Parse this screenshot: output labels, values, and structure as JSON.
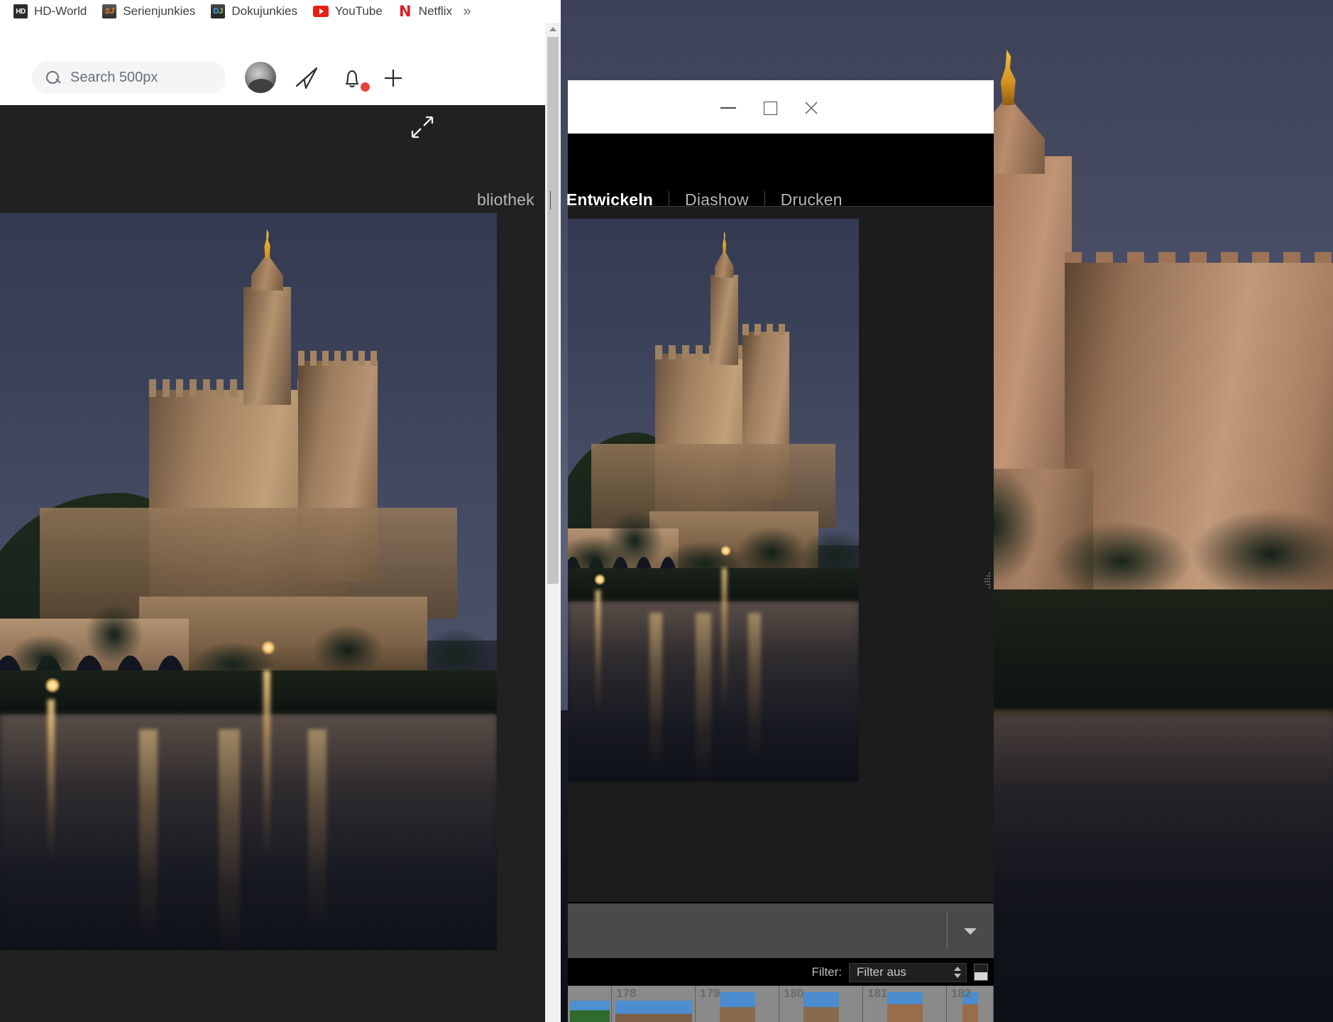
{
  "browser": {
    "bookmarks": [
      {
        "label": "HD-World",
        "icon": "hd-world-icon"
      },
      {
        "label": "Serienjunkies",
        "icon": "serienjunkies-icon"
      },
      {
        "label": "Dokujunkies",
        "icon": "dokujunkies-icon"
      },
      {
        "label": "YouTube",
        "icon": "youtube-icon"
      },
      {
        "label": "Netflix",
        "icon": "netflix-icon"
      }
    ],
    "overflow_label": "»",
    "search": {
      "placeholder": "Search 500px",
      "value": "",
      "icon": "search-icon"
    },
    "toolbar_icons": [
      {
        "name": "avatar",
        "label": ""
      },
      {
        "name": "send-icon",
        "label": ""
      },
      {
        "name": "bell-icon",
        "label": ""
      },
      {
        "name": "plus-icon",
        "label": ""
      }
    ],
    "notification_badge": true,
    "expand_icon": "expand-icon",
    "scrollbar": {
      "up_arrow_icon": "caret-up-icon"
    }
  },
  "lightroom": {
    "window_controls": {
      "minimize": "minimize-icon",
      "maximize": "maximize-icon",
      "close": "close-icon"
    },
    "modules": [
      {
        "label": "bliothek",
        "active": false
      },
      {
        "label": "Entwickeln",
        "active": true
      },
      {
        "label": "Diashow",
        "active": false
      },
      {
        "label": "Drucken",
        "active": false
      }
    ],
    "bottom_bar": {
      "caret_icon": "caret-down-icon"
    },
    "filter_bar": {
      "label": "Filter:",
      "selected": "Filter aus",
      "stepper_icon": "stepper-updown-icon",
      "toggle_icon": "filter-toggle-icon"
    },
    "filmstrip": {
      "items": [
        {
          "number": "",
          "thumb": "landscape-hill"
        },
        {
          "number": "178",
          "thumb": "landscape-sky"
        },
        {
          "number": "179",
          "thumb": "tower-portrait"
        },
        {
          "number": "180",
          "thumb": "tower-portrait"
        },
        {
          "number": "181",
          "thumb": "houses-portrait"
        },
        {
          "number": "182",
          "thumb": "partial"
        }
      ]
    },
    "panel_grip_icon": "panel-collapse-grip-icon"
  },
  "colors": {
    "browser_chrome": "#ffffff",
    "browser_content": "#212121",
    "lightroom_chrome": "#000000",
    "lightroom_pane": "#1c1c1c",
    "lightroom_bottom_bar": "#4a4a4a",
    "filmstrip": "#848484",
    "accent_red": "#e8433a",
    "netflix_red": "#d81f26",
    "youtube_red": "#e62117"
  }
}
